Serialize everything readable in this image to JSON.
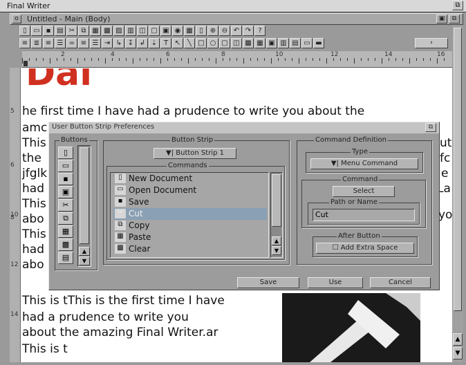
{
  "screen": {
    "title": "Final Writer"
  },
  "window": {
    "title": "Untitled - Main (Body)",
    "close_glyph": "o"
  },
  "ruler": {
    "numbers": [
      "2",
      "4",
      "6",
      "8",
      "10",
      "12",
      "14",
      "16"
    ]
  },
  "left_ruler": {
    "numbers": [
      "5",
      "6",
      "8",
      "10",
      "12",
      "14"
    ]
  },
  "document": {
    "heading_fragment": "Dal",
    "lines": [
      "he first time I have had a prudence to write you about the",
      "amc",
      "This",
      "the",
      "jfglk",
      "had",
      "This",
      "abo",
      "This",
      "had",
      "abo",
      "This is tThis is the first time I have",
      "had a prudence to write you",
      "about the amazing Final Writer.ar",
      "This is t"
    ],
    "right_fragments": [
      "ut",
      "fc",
      "e",
      "La",
      "yo"
    ]
  },
  "dialog": {
    "title": "User Button Strip Preferences",
    "buttons_group_label": "Buttons",
    "button_strip_group_label": "Button Strip",
    "button_strip_value": "Button Strip 1",
    "commands_label": "Commands",
    "commands": [
      {
        "label": "New Document",
        "icon": "page-icon"
      },
      {
        "label": "Open Document",
        "icon": "folder-icon"
      },
      {
        "label": "Save",
        "icon": "disk-icon"
      },
      {
        "label": "Cut",
        "icon": "scissors-icon",
        "selected": true
      },
      {
        "label": "Copy",
        "icon": "copy-icon"
      },
      {
        "label": "Paste",
        "icon": "paste-icon"
      },
      {
        "label": "Clear",
        "icon": "clear-icon"
      }
    ],
    "command_definition_label": "Command Definition",
    "type_label": "Type",
    "type_value": "Menu Command",
    "command_label": "Command",
    "select_label": "Select",
    "path_label": "Path or Name",
    "path_value": "Cut",
    "after_button_label": "After Button",
    "add_extra_space_label": "Add Extra Space",
    "save_label": "Save",
    "use_label": "Use",
    "cancel_label": "Cancel"
  }
}
